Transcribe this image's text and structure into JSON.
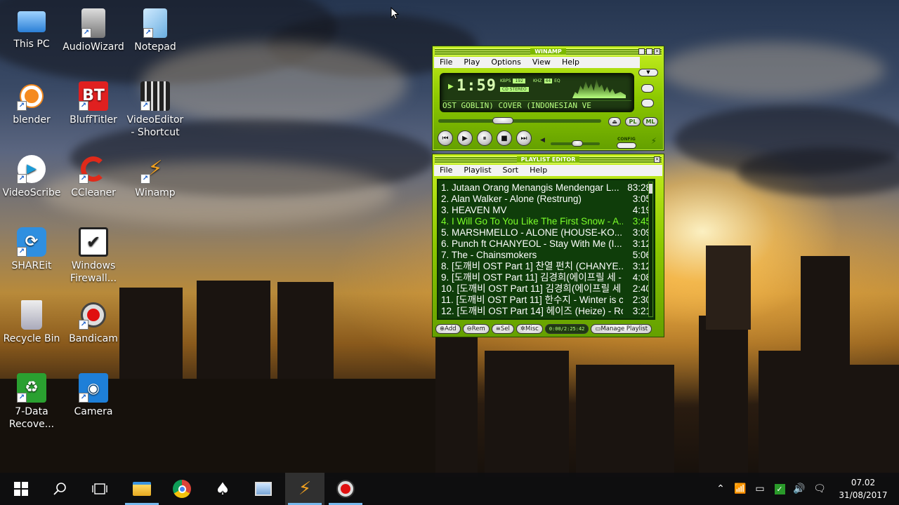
{
  "desktop_icons": [
    {
      "label": "This PC",
      "icon": "this-pc-icon"
    },
    {
      "label": "AudioWizard",
      "icon": "audiowizard-icon"
    },
    {
      "label": "Notepad",
      "icon": "notepad-icon"
    },
    {
      "label": "blender",
      "icon": "blender-icon"
    },
    {
      "label": "BluffTitler",
      "icon": "blufftitler-icon"
    },
    {
      "label": "VideoEditor - Shortcut",
      "icon": "videoeditor-icon"
    },
    {
      "label": "VideoScribe",
      "icon": "videoscribe-icon"
    },
    {
      "label": "CCleaner",
      "icon": "ccleaner-icon"
    },
    {
      "label": "Winamp",
      "icon": "winamp-icon"
    },
    {
      "label": "SHAREit",
      "icon": "shareit-icon"
    },
    {
      "label": "Windows Firewall...",
      "icon": "firewall-icon"
    },
    {
      "label": "Recycle Bin",
      "icon": "recycle-bin-icon"
    },
    {
      "label": "Bandicam",
      "icon": "bandicam-icon"
    },
    {
      "label": "7-Data Recove...",
      "icon": "data-recovery-icon"
    },
    {
      "label": "Camera",
      "icon": "camera-icon"
    }
  ],
  "winamp": {
    "title": "WINAMP",
    "menu": [
      "File",
      "Play",
      "Options",
      "View",
      "Help"
    ],
    "time": "1:59",
    "kbps": "192",
    "khz": "44",
    "kbps_label": "KBPS",
    "khz_label": "KHZ",
    "stereo_label": "CD STEREO",
    "eq_label": "EQ",
    "ticker": "OST GOBLIN) COVER (INDONESIAN VE",
    "pl_button": "PL",
    "ml_button": "ML",
    "config_label": "CONFIG",
    "volume": 0.55,
    "position": 0.38
  },
  "playlist": {
    "title": "PLAYLIST EDITOR",
    "menu": [
      "File",
      "Playlist",
      "Sort",
      "Help"
    ],
    "current_index": 3,
    "tracks": [
      {
        "title": "1. Jutaan Orang Menangis Mendengar L...",
        "duration": "83:28"
      },
      {
        "title": "2. Alan Walker - Alone (Restrung)",
        "duration": "3:05"
      },
      {
        "title": "3. HEAVEN MV",
        "duration": "4:19"
      },
      {
        "title": "4. I Will Go To You Like The First Snow - A...",
        "duration": "3:45"
      },
      {
        "title": "5. MARSHMELLO - ALONE (HOUSE-KO...",
        "duration": "3:09"
      },
      {
        "title": "6. Punch ft  CHANYEOL - Stay With Me (I...",
        "duration": "3:12"
      },
      {
        "title": "7. The - Chainsmokers",
        "duration": "5:06"
      },
      {
        "title": "8. [도깨비 OST Part 1] 찬열 펀치 (CHANYE...",
        "duration": "3:12"
      },
      {
        "title": "9. [도깨비 OST Part 11] 김경희(에이프릴 세 - ...",
        "duration": "4:08"
      },
      {
        "title": "10. [도깨비 OST Part 11] 김경희(에이프릴 세 - ...",
        "duration": "2:40"
      },
      {
        "title": "11. [도깨비 OST Part 11] 한수지 - Winter is c...",
        "duration": "2:30"
      },
      {
        "title": "12. [도깨비 OST Part 14] 헤이즈 (Heize) - Ro...",
        "duration": "3:21"
      }
    ],
    "buttons": [
      "Add",
      "Rem",
      "Sel",
      "Misc"
    ],
    "total_time": "0:00/2:25:42",
    "manage": "Manage Playlist"
  },
  "taskbar": {
    "apps": [
      "start-icon",
      "search-icon",
      "task-view-icon",
      "file-explorer-icon",
      "chrome-icon",
      "solitaire-icon",
      "photos-icon",
      "winamp-icon",
      "bandicam-icon"
    ],
    "time": "07.02",
    "date": "31/08/2017"
  }
}
